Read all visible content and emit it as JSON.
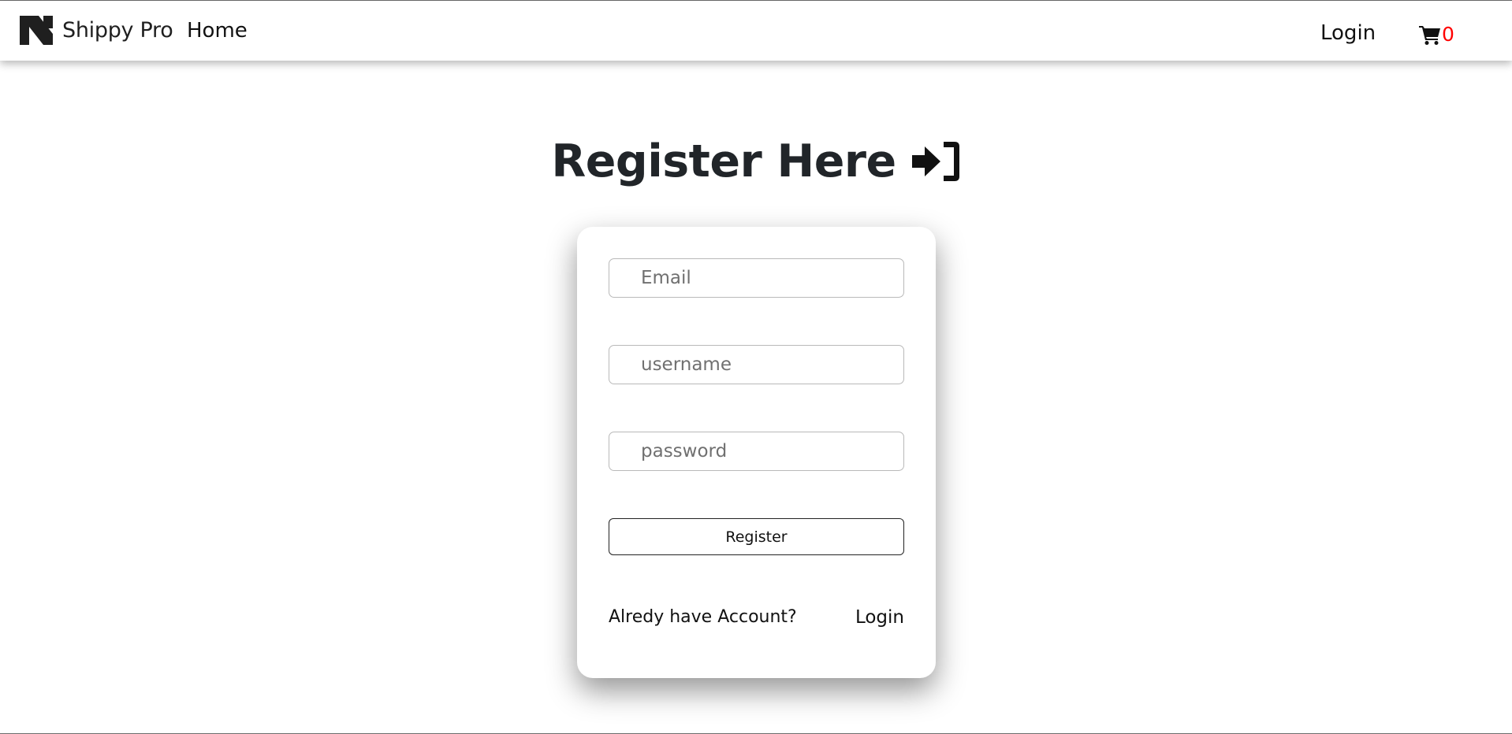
{
  "navbar": {
    "brand_name": "Shippy Pro",
    "home_label": "Home",
    "login_label": "Login",
    "cart_count": "0",
    "cart_icon": "shopping-cart-icon",
    "logo_icon": "n-logo-icon"
  },
  "main": {
    "heading": "Register Here",
    "heading_icon": "sign-in-arrow-icon"
  },
  "form": {
    "email_placeholder": "Email",
    "email_value": "",
    "username_placeholder": "username",
    "username_value": "",
    "password_placeholder": "password",
    "password_value": "",
    "register_label": "Register",
    "already_text": "Alredy have Account?",
    "login_link": "Login"
  },
  "colors": {
    "cart_count": "#ff0000",
    "text": "#212529",
    "background": "#ffffff"
  }
}
